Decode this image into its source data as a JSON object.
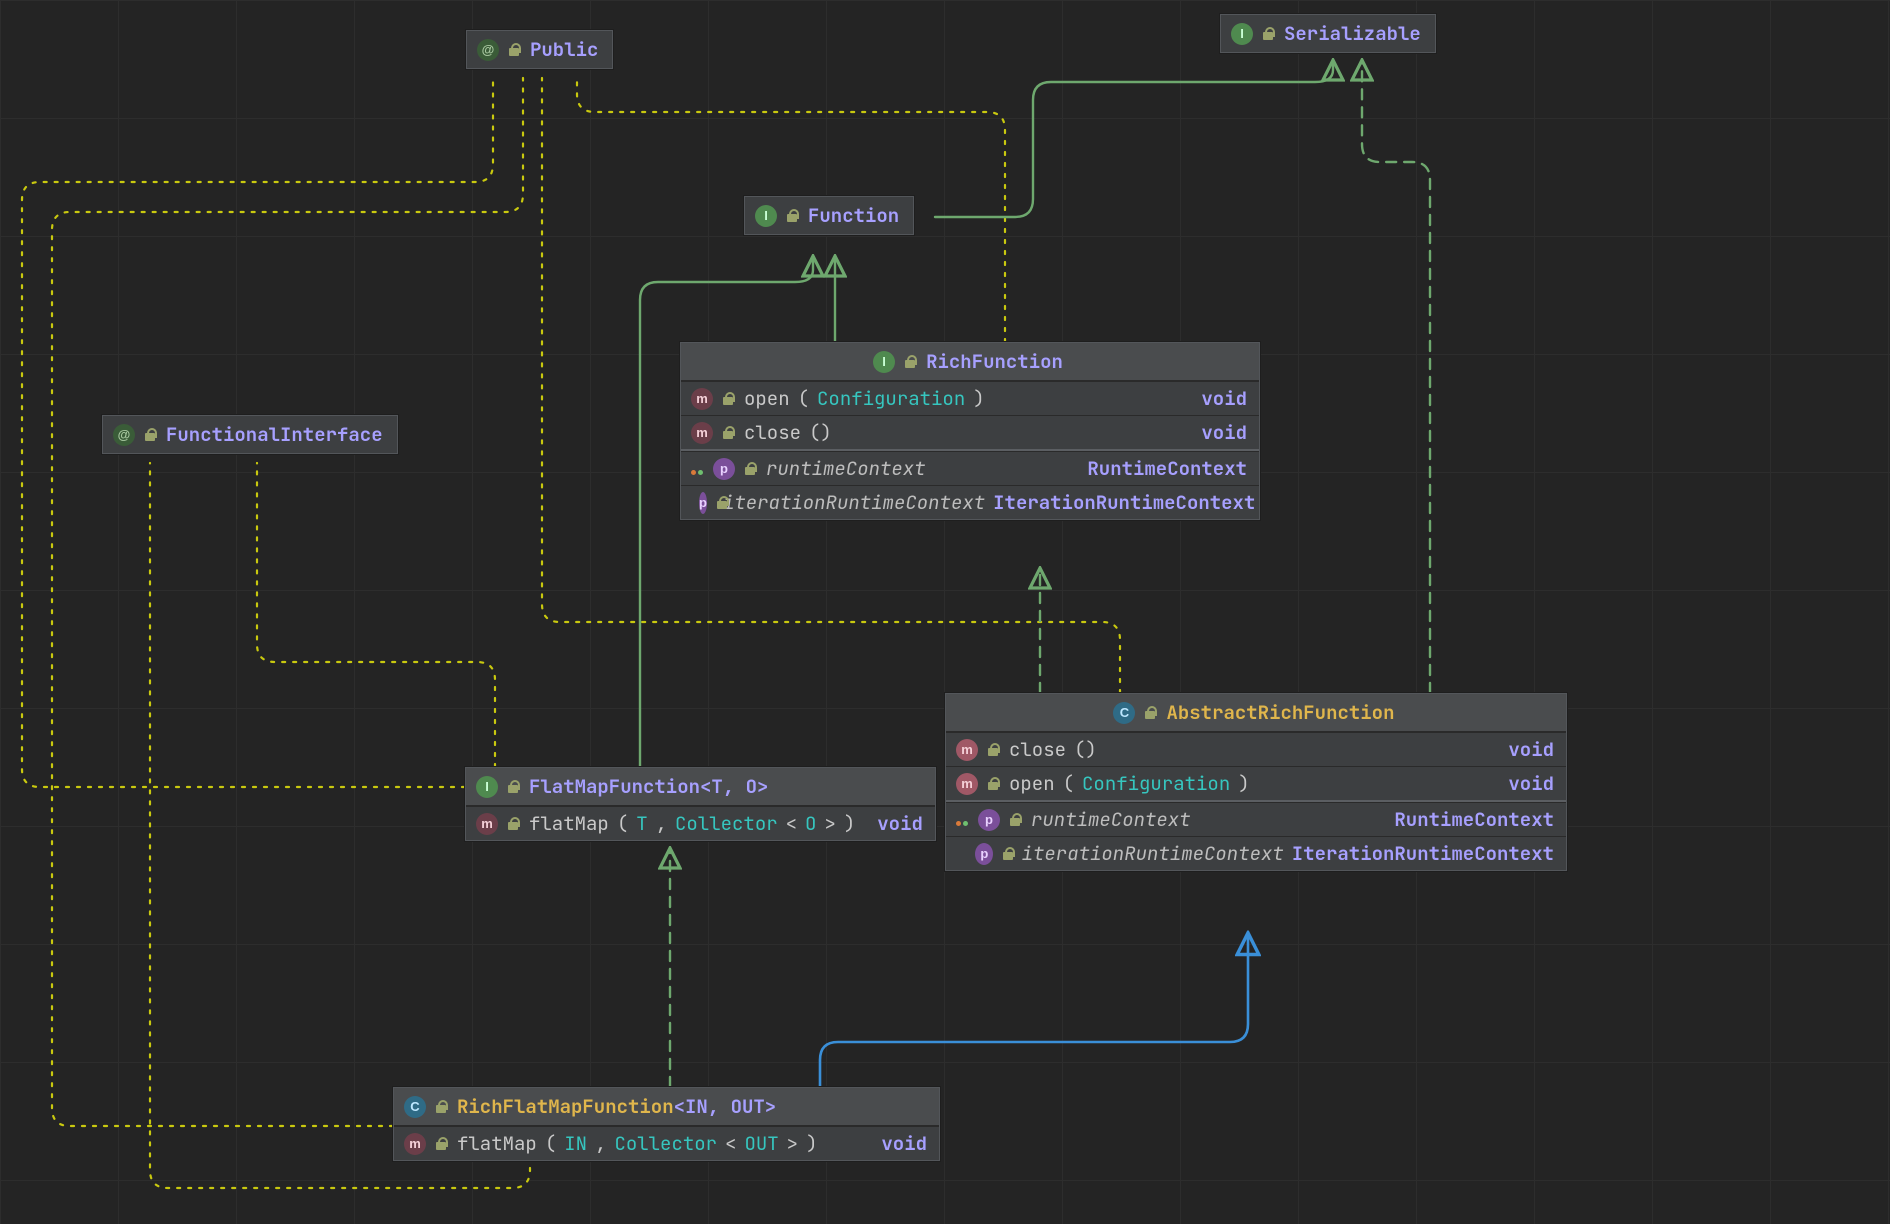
{
  "nodes": {
    "public": {
      "kind": "A",
      "title": "Public"
    },
    "serializable": {
      "kind": "I",
      "title": "Serializable"
    },
    "function": {
      "kind": "I",
      "title": "Function"
    },
    "functionalInterface": {
      "kind": "A",
      "title": "FunctionalInterface"
    },
    "richFunction": {
      "kind": "I",
      "title": "RichFunction",
      "methods": [
        {
          "icon": "m.ab",
          "name": "open",
          "params": "Configuration",
          "ret": "void"
        },
        {
          "icon": "m.ab",
          "name": "close",
          "params": "",
          "ret": "void"
        }
      ],
      "props": [
        {
          "icon": "p",
          "name": "runtimeContext",
          "ret": "RuntimeContext"
        },
        {
          "icon": "p",
          "name": "iterationRuntimeContext",
          "ret": "IterationRuntimeContext"
        }
      ]
    },
    "flatMapFunction": {
      "kind": "I",
      "title": "FlatMapFunction",
      "generics": "<T, O>",
      "methods": [
        {
          "icon": "m.ab",
          "name": "flatMap",
          "params_tokens": [
            "T",
            ", ",
            "Collector",
            "<",
            "O",
            ">"
          ],
          "ret": "void"
        }
      ]
    },
    "abstractRichFunction": {
      "kind": "C",
      "title": "AbstractRichFunction",
      "methods": [
        {
          "icon": "m",
          "name": "close",
          "params": "",
          "ret": "void"
        },
        {
          "icon": "m",
          "name": "open",
          "params": "Configuration",
          "ret": "void"
        }
      ],
      "props": [
        {
          "icon": "p",
          "name": "runtimeContext",
          "ret": "RuntimeContext"
        },
        {
          "icon": "p",
          "name": "iterationRuntimeContext",
          "ret": "IterationRuntimeContext"
        }
      ]
    },
    "richFlatMapFunction": {
      "kind": "C",
      "title": "RichFlatMapFunction",
      "generics": "<IN, OUT>",
      "methods": [
        {
          "icon": "m.ab",
          "name": "flatMap",
          "params_tokens": [
            "IN",
            ", ",
            "Collector",
            "<",
            "OUT",
            ">"
          ],
          "ret": "void"
        }
      ]
    }
  },
  "legend_colors": {
    "inherit_solid": "#6ea86e",
    "implement_dashed": "#6ea86e",
    "annotation_dotted": "#c9c90f",
    "extends_class": "#3a8fd8"
  }
}
